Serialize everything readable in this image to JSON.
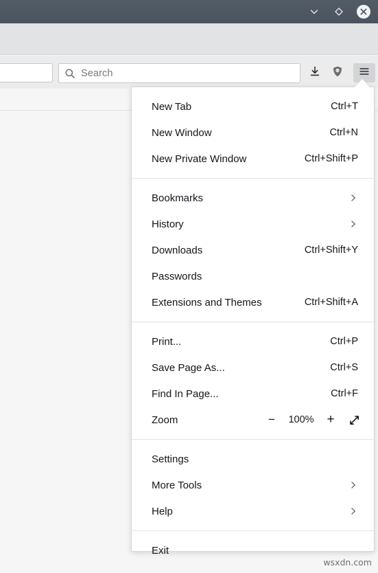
{
  "window": {
    "controls": [
      {
        "name": "minimize",
        "icon": "chevron-down-icon"
      },
      {
        "name": "maximize",
        "icon": "diamond-icon"
      },
      {
        "name": "close",
        "icon": "close-icon"
      }
    ]
  },
  "toolbar": {
    "url_value": "",
    "search": {
      "placeholder": "Search",
      "value": "",
      "icon": "search-icon"
    },
    "buttons": [
      {
        "name": "downloads",
        "icon": "download-icon",
        "label": "Downloads"
      },
      {
        "name": "ublock-origin",
        "icon": "shield-icon",
        "label": "uBlock Origin"
      },
      {
        "name": "application-menu",
        "icon": "hamburger-icon",
        "label": "Open application menu"
      }
    ]
  },
  "menu": {
    "groups": [
      {
        "items": [
          {
            "label": "New Tab",
            "shortcut": "Ctrl+T",
            "submenu": false
          },
          {
            "label": "New Window",
            "shortcut": "Ctrl+N",
            "submenu": false
          },
          {
            "label": "New Private Window",
            "shortcut": "Ctrl+Shift+P",
            "submenu": false
          }
        ]
      },
      {
        "items": [
          {
            "label": "Bookmarks",
            "shortcut": "",
            "submenu": true
          },
          {
            "label": "History",
            "shortcut": "",
            "submenu": true
          },
          {
            "label": "Downloads",
            "shortcut": "Ctrl+Shift+Y",
            "submenu": false
          },
          {
            "label": "Passwords",
            "shortcut": "",
            "submenu": false
          },
          {
            "label": "Extensions and Themes",
            "shortcut": "Ctrl+Shift+A",
            "submenu": false
          }
        ]
      },
      {
        "items": [
          {
            "label": "Print...",
            "shortcut": "Ctrl+P",
            "submenu": false
          },
          {
            "label": "Save Page As...",
            "shortcut": "Ctrl+S",
            "submenu": false
          },
          {
            "label": "Find In Page...",
            "shortcut": "Ctrl+F",
            "submenu": false
          }
        ],
        "zoom": {
          "label": "Zoom",
          "value": "100%",
          "minus_label": "−",
          "plus_label": "+",
          "fullscreen_icon": "expand-arrows-icon"
        }
      },
      {
        "items": [
          {
            "label": "Settings",
            "shortcut": "",
            "submenu": false
          },
          {
            "label": "More Tools",
            "shortcut": "",
            "submenu": true
          },
          {
            "label": "Help",
            "shortcut": "",
            "submenu": true
          }
        ]
      },
      {
        "items": [
          {
            "label": "Exit",
            "shortcut": "",
            "submenu": false
          }
        ]
      }
    ]
  },
  "watermark": {
    "text": "wsxdn.com"
  },
  "colors": {
    "titlebar": "#4e5862",
    "toolbar": "#e2e3e5",
    "navbar": "#ececed",
    "panel_bg": "#ffffff",
    "text": "#15141a",
    "separator": "#e3e3e5"
  }
}
